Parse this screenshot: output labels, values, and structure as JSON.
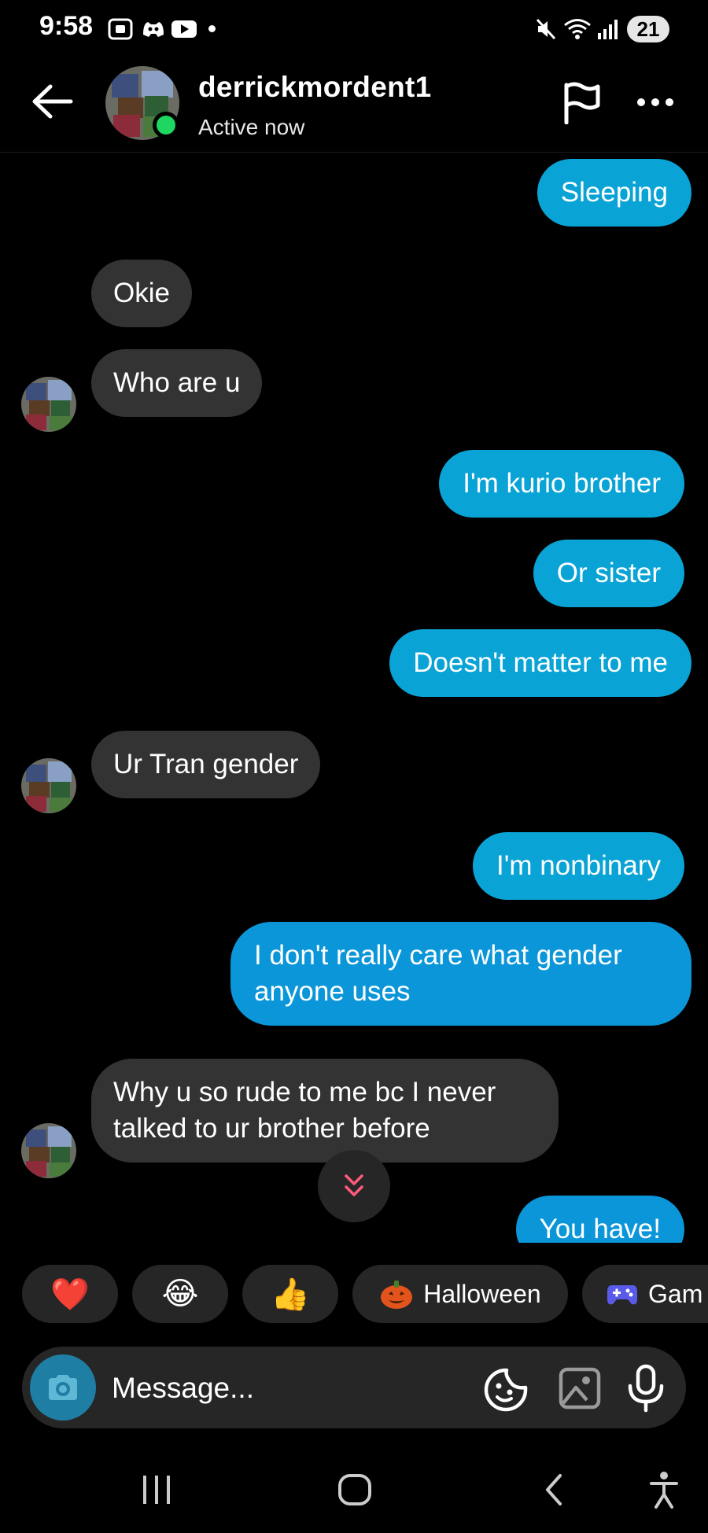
{
  "status_bar": {
    "time": "9:58",
    "battery": "21"
  },
  "header": {
    "username": "derrickmordent1",
    "status": "Active now"
  },
  "messages": [
    {
      "side": "sent",
      "text": "Sleeping"
    },
    {
      "side": "received",
      "text": "Okie"
    },
    {
      "side": "received",
      "text": "Who are u"
    },
    {
      "side": "sent",
      "text": "I'm kurio brother"
    },
    {
      "side": "sent",
      "text": "Or sister"
    },
    {
      "side": "sent",
      "text": "Doesn't matter to me"
    },
    {
      "side": "received",
      "text": "Ur Tran gender"
    },
    {
      "side": "sent",
      "text": "I'm nonbinary"
    },
    {
      "side": "sent",
      "text": "I don't really care what gender anyone uses"
    },
    {
      "side": "received",
      "text": "Why u so rude to me bc I never talked to ur brother before"
    },
    {
      "side": "sent",
      "text": "You have!"
    }
  ],
  "quick_replies": [
    {
      "label": "❤️",
      "icon": "heart-emoji"
    },
    {
      "label": "😂",
      "icon": "laughing-emoji"
    },
    {
      "label": "👍",
      "icon": "thumbs-up-emoji"
    },
    {
      "label": "Halloween",
      "icon": "pumpkin-emoji"
    },
    {
      "label": "Gam",
      "icon": "gamepad-emoji"
    }
  ],
  "composer": {
    "placeholder": "Message..."
  },
  "colors": {
    "sent_bubble": "#0aa3d6",
    "received_bubble": "#333334",
    "active_dot": "#1ed760",
    "background": "#000000"
  }
}
